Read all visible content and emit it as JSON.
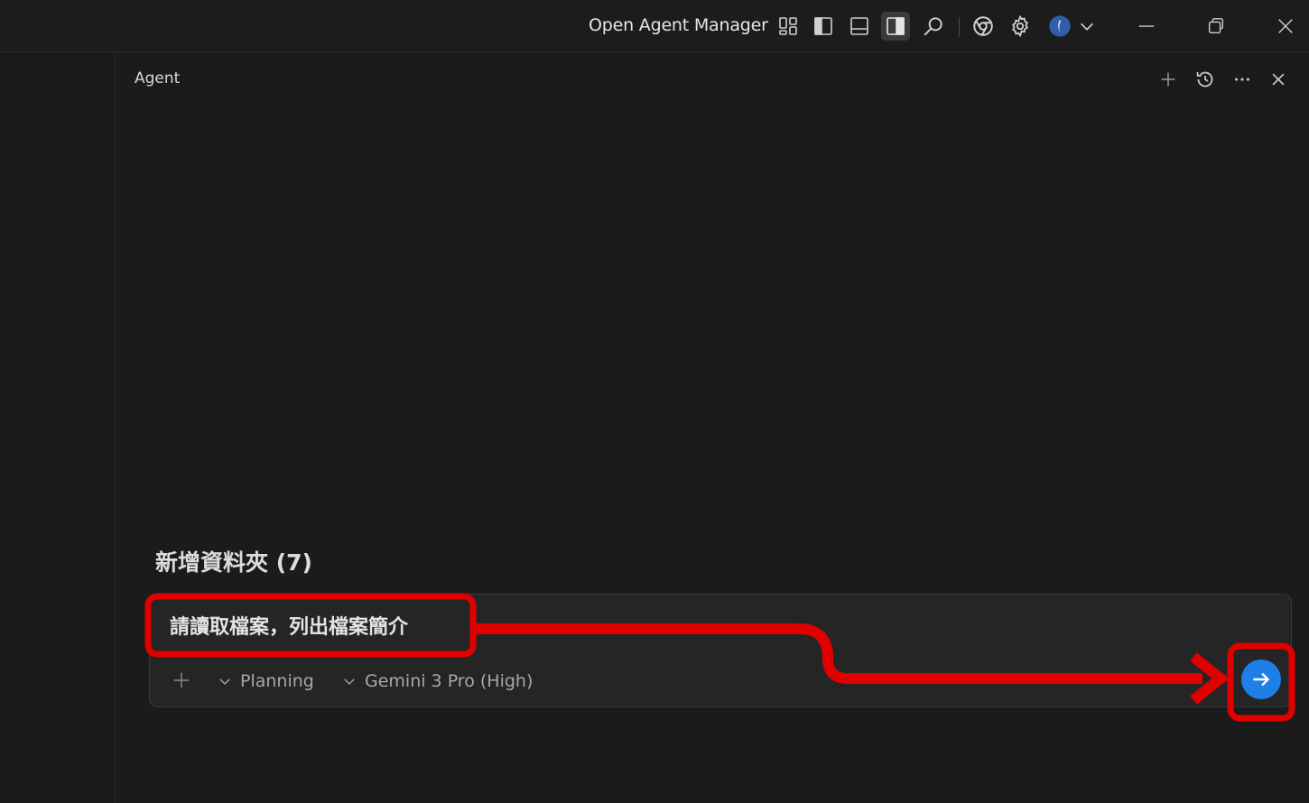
{
  "titlebar": {
    "app_title": "Open Agent Manager",
    "icons": [
      "layout-grid-icon",
      "toggle-primary-sidebar-icon",
      "toggle-panel-icon",
      "toggle-secondary-sidebar-icon",
      "search-icon",
      "chrome-icon",
      "gear-icon",
      "account-icon",
      "chevron-down-icon",
      "minimize-icon",
      "restore-icon",
      "close-icon"
    ]
  },
  "panel": {
    "title": "Agent",
    "header_icons": [
      "plus-icon",
      "history-icon",
      "more-icon",
      "close-icon"
    ]
  },
  "conversation": {
    "title": "新增資料夾 (7)"
  },
  "composer": {
    "text": "請讀取檔案，列出檔案簡介",
    "mode_label": "Planning",
    "model_label": "Gemini 3 Pro (High)"
  },
  "colors": {
    "background": "#1b1b1b",
    "accent": "#1e7fe6",
    "annotation": "#e00000"
  }
}
